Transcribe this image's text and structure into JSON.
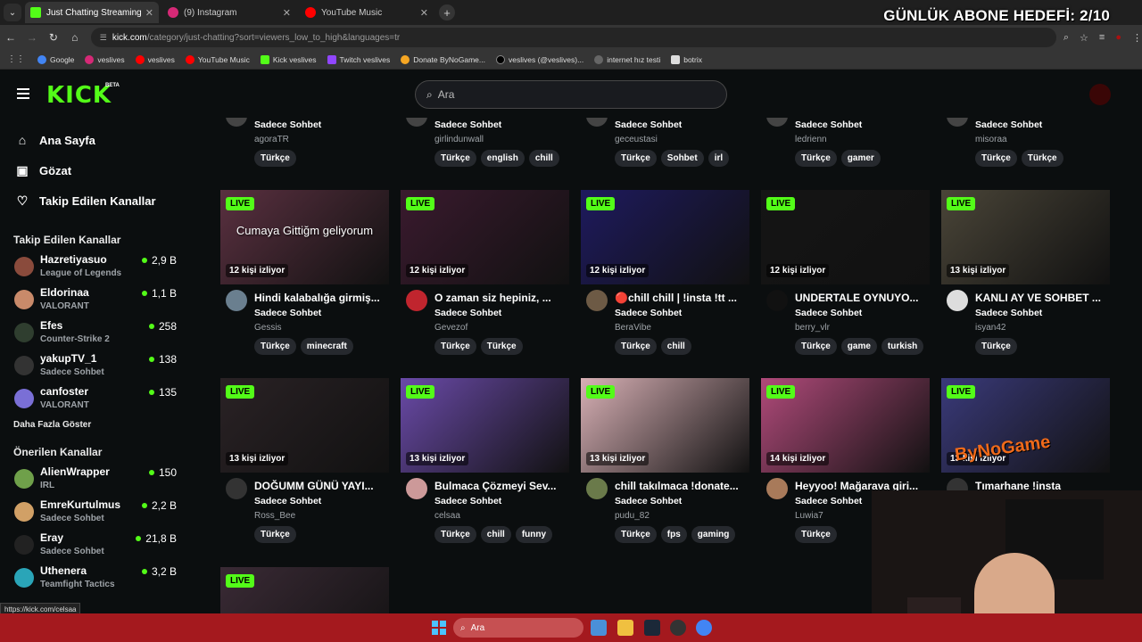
{
  "tabs": [
    {
      "title": "Just Chatting Streaming - Live S",
      "color": "#53fc18",
      "active": true
    },
    {
      "title": "(9) Instagram",
      "color": "#d62976",
      "active": false
    },
    {
      "title": "YouTube Music",
      "color": "#ff0000",
      "active": false
    }
  ],
  "overlay_goal": "GÜNLÜK ABONE HEDEFİ: 2/10",
  "address": {
    "host": "kick.com",
    "path": "/category/just-chatting?sort=viewers_low_to_high&languages=tr"
  },
  "bookmarks": [
    {
      "label": "Google",
      "color": "#4285f4"
    },
    {
      "label": "veslives",
      "color": "#d62976"
    },
    {
      "label": "veslives",
      "color": "#ff0000"
    },
    {
      "label": "YouTube Music",
      "color": "#ff0000"
    },
    {
      "label": "Kick veslives",
      "color": "#53fc18"
    },
    {
      "label": "Twitch veslives",
      "color": "#9146ff"
    },
    {
      "label": "Donate ByNoGame...",
      "color": "#f5a623"
    },
    {
      "label": "veslives (@veslives)...",
      "color": "#111111"
    },
    {
      "label": "internet hız testi",
      "color": "#666666"
    },
    {
      "label": "botrix",
      "color": "#dddddd"
    }
  ],
  "header": {
    "logo": "KICK",
    "beta": "BETA",
    "search_placeholder": "Ara"
  },
  "sidebar": {
    "nav": [
      {
        "label": "Ana Sayfa",
        "icon": "home-icon"
      },
      {
        "label": "Gözat",
        "icon": "browse-icon"
      },
      {
        "label": "Takip Edilen Kanallar",
        "icon": "heart-icon"
      }
    ],
    "followed_title": "Takip Edilen Kanallar",
    "followed": [
      {
        "name": "Hazretiyasuo",
        "category": "League of Legends",
        "viewers": "2,9 B",
        "color": "#8a4b3c"
      },
      {
        "name": "Eldorinaa",
        "category": "VALORANT",
        "viewers": "1,1 B",
        "color": "#c98a6a"
      },
      {
        "name": "Efes",
        "category": "Counter-Strike 2",
        "viewers": "258",
        "color": "#2f3e2f"
      },
      {
        "name": "yakupTV_1",
        "category": "Sadece Sohbet",
        "viewers": "138",
        "color": "#333"
      },
      {
        "name": "canfoster",
        "category": "VALORANT",
        "viewers": "135",
        "color": "#7a6fd6"
      }
    ],
    "show_more": "Daha Fazla Göster",
    "recommended_title": "Önerilen Kanallar",
    "recommended": [
      {
        "name": "AlienWrapper",
        "category": "IRL",
        "viewers": "150",
        "color": "#6fa04a"
      },
      {
        "name": "EmreKurtulmus",
        "category": "Sadece Sohbet",
        "viewers": "2,2 B",
        "color": "#d1a066"
      },
      {
        "name": "Eray",
        "category": "Sadece Sohbet",
        "viewers": "21,8 B",
        "color": "#222"
      },
      {
        "name": "Uthenera",
        "category": "Teamfight Tactics",
        "viewers": "3,2 B",
        "color": "#2aa5b8"
      }
    ]
  },
  "top_row": [
    {
      "category": "Sadece Sohbet",
      "user": "agoraTR",
      "tags": [
        "Türkçe"
      ]
    },
    {
      "category": "Sadece Sohbet",
      "user": "girlindunwall",
      "tags": [
        "Türkçe",
        "english",
        "chill"
      ]
    },
    {
      "category": "Sadece Sohbet",
      "user": "geceustasi",
      "tags": [
        "Türkçe",
        "Sohbet",
        "irl"
      ]
    },
    {
      "category": "Sadece Sohbet",
      "user": "ledrienn",
      "tags": [
        "Türkçe",
        "gamer"
      ]
    },
    {
      "category": "Sadece Sohbet",
      "user": "misoraa",
      "tags": [
        "Türkçe",
        "Türkçe"
      ]
    }
  ],
  "row2": [
    {
      "live": "LIVE",
      "viewers": "12 kişi izliyor",
      "title": "Hindi kalabalığa girmiş...",
      "category": "Sadece Sohbet",
      "user": "Gessis",
      "tags": [
        "Türkçe",
        "minecraft"
      ],
      "overlay": "Cumaya Gittiğm geliyorum",
      "bg": "#5a3040",
      "avatar": "#6a7f8f"
    },
    {
      "live": "LIVE",
      "viewers": "12 kişi izliyor",
      "title": "O zaman siz hepiniz, ...",
      "category": "Sadece Sohbet",
      "user": "Gevezof",
      "tags": [
        "Türkçe",
        "Türkçe"
      ],
      "overlay": "",
      "bg": "#3a1a2e",
      "avatar": "#c0252e"
    },
    {
      "live": "LIVE",
      "viewers": "12 kişi izliyor",
      "title": "🔴chill chill | !insta !tt ...",
      "category": "Sadece Sohbet",
      "user": "BeraVibe",
      "tags": [
        "Türkçe",
        "chill"
      ],
      "overlay": "",
      "bg": "#1e1a5e",
      "avatar": "#6d5a45"
    },
    {
      "live": "LIVE",
      "viewers": "12 kişi izliyor",
      "title": "UNDERTALE OYNUYO...",
      "category": "Sadece Sohbet",
      "user": "berry_vlr",
      "tags": [
        "Türkçe",
        "game",
        "turkish"
      ],
      "overlay": "",
      "bg": "#151515",
      "avatar": "#111"
    },
    {
      "live": "LIVE",
      "viewers": "13 kişi izliyor",
      "title": "KANLI AY VE SOHBET ...",
      "category": "Sadece Sohbet",
      "user": "isyan42",
      "tags": [
        "Türkçe"
      ],
      "overlay": "",
      "bg": "#4a4538",
      "avatar": "#ddd"
    }
  ],
  "row3": [
    {
      "live": "LIVE",
      "viewers": "13 kişi izliyor",
      "title": "DOĞUMM GÜNÜ YAYI...",
      "category": "Sadece Sohbet",
      "user": "Ross_Bee",
      "tags": [
        "Türkçe"
      ],
      "bg": "#2a2225",
      "avatar": "#333"
    },
    {
      "live": "LIVE",
      "viewers": "13 kişi izliyor",
      "title": "Bulmaca Çözmeyi Sev...",
      "category": "Sadece Sohbet",
      "user": "celsaa",
      "tags": [
        "Türkçe",
        "chill",
        "funny"
      ],
      "bg": "#6a4aa8",
      "avatar": "#c99"
    },
    {
      "live": "LIVE",
      "viewers": "13 kişi izliyor",
      "title": "chill takılmaca !donate...",
      "category": "Sadece Sohbet",
      "user": "pudu_82",
      "tags": [
        "Türkçe",
        "fps",
        "gaming"
      ],
      "bg": "#d8b0b5",
      "avatar": "#6a7a4a"
    },
    {
      "live": "LIVE",
      "viewers": "14 kişi izliyor",
      "title": "Heyyoo! Mağarava giri...",
      "category": "Sadece Sohbet",
      "user": "Luwia7",
      "tags": [
        "Türkçe"
      ],
      "bg": "#b04a7a",
      "avatar": "#a87a5a"
    },
    {
      "live": "LIVE",
      "viewers": "13 kişi izliyor",
      "title": "Tımarhane !insta",
      "category": "",
      "user": "",
      "tags": [],
      "bg": "#3a3a7a",
      "avatar": "#333"
    }
  ],
  "row4": {
    "live": "LIVE",
    "bg": "#3a2a35"
  },
  "overlay_brand": "ByNoGame",
  "taskbar": {
    "search": "Ara"
  },
  "status_url": "https://kick.com/celsaa"
}
